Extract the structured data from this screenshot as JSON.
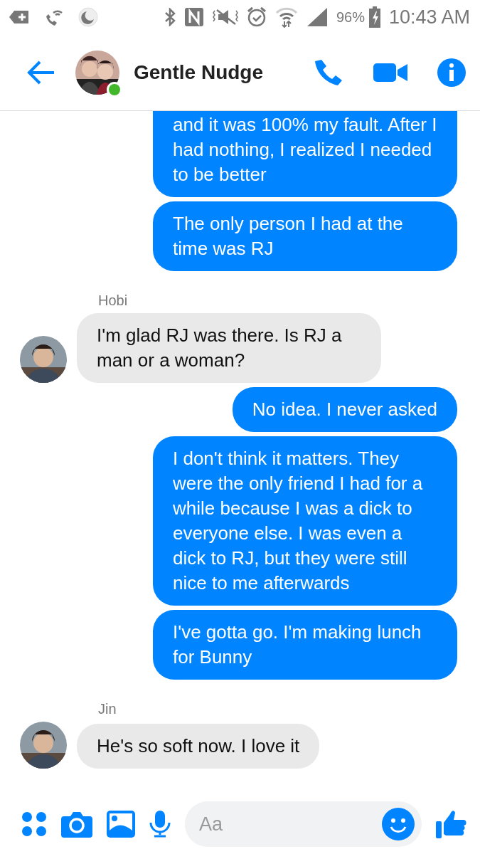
{
  "status_bar": {
    "battery": "96%",
    "time": "10:43 AM"
  },
  "header": {
    "title": "Gentle Nudge",
    "online": true
  },
  "messages": [
    {
      "kind": "sent",
      "text": "and it was 100% my fault. After I had nothing, I realized I needed to be better"
    },
    {
      "kind": "sent",
      "text": "The only person I had at the time was RJ"
    },
    {
      "kind": "received",
      "sender": "Hobi",
      "text": "I'm glad RJ was there. Is RJ a man or a woman?"
    },
    {
      "kind": "sent",
      "text": "No idea. I never asked"
    },
    {
      "kind": "sent",
      "text": "I don't think it matters. They were the only friend I had for a while because I was a dick to everyone else. I was even a dick to RJ, but they were still nice to me afterwards"
    },
    {
      "kind": "sent",
      "text": "I've gotta go. I'm making lunch for Bunny"
    },
    {
      "kind": "received",
      "sender": "Jin",
      "text": "He's so soft now. I love it"
    }
  ],
  "composer": {
    "placeholder": "Aa"
  }
}
